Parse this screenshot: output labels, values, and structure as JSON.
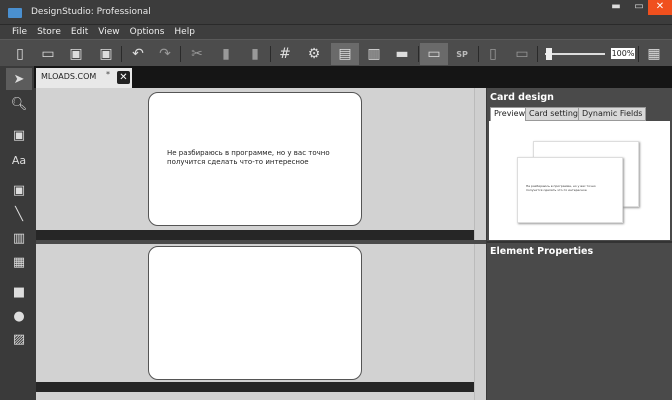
{
  "window": {
    "title": "DesignStudio: Professional",
    "minimize": "▬",
    "maximize": "▭",
    "close": "✕",
    "close_color": "#f0501e"
  },
  "menu": [
    "File",
    "Store",
    "Edit",
    "View",
    "Options",
    "Help"
  ],
  "toolbar": {
    "zoom": "100%",
    "sp_label": "SP"
  },
  "document_tab": {
    "label": "MLOADS.COM",
    "modified": "*",
    "close": "✕"
  },
  "card": {
    "text": "Не разбираюсь в программе, но у вас точно получится сделать что-то интересное"
  },
  "right_panel": {
    "card_design": "Card design",
    "tabs": [
      "Preview",
      "Card settings",
      "Dynamic Fields"
    ],
    "active_tab": "Preview",
    "element_properties": "Element Properties"
  }
}
